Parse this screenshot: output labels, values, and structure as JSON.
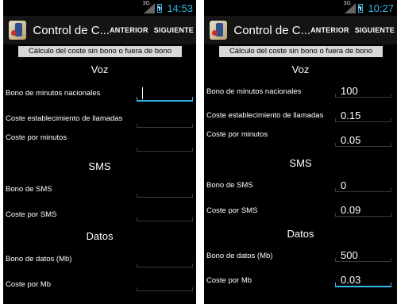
{
  "left": {
    "status": {
      "network": "3G",
      "time": "14:53"
    },
    "actionbar": {
      "title": "Control de C...",
      "prev": "ANTERIOR",
      "next": "SIGUIENTE"
    },
    "header": "Cálculo del coste sin bono o fuera de bono",
    "sections": {
      "voz": "Voz",
      "sms": "SMS",
      "datos": "Datos"
    },
    "labels": {
      "bono_minutos": "Bono de minutos nacionales",
      "coste_establecimiento": "Coste establecimiento de llamadas",
      "coste_minutos": "Coste por minutos",
      "bono_sms": "Bono de SMS",
      "coste_sms": "Coste por SMS",
      "bono_datos": "Bono de datos (Mb)",
      "coste_mb": "Coste por Mb"
    },
    "values": {
      "bono_minutos": "",
      "coste_establecimiento": "",
      "coste_minutos": "",
      "bono_sms": "",
      "coste_sms": "",
      "bono_datos": "",
      "coste_mb": ""
    }
  },
  "right": {
    "status": {
      "network": "3G",
      "time": "10:27"
    },
    "actionbar": {
      "title": "Control de C...",
      "prev": "ANTERIOR",
      "next": "SIGUIENTE"
    },
    "header": "Cálculo del coste sin bono o fuera de bono",
    "sections": {
      "voz": "Voz",
      "sms": "SMS",
      "datos": "Datos"
    },
    "labels": {
      "bono_minutos": "Bono de minutos nacionales",
      "coste_establecimiento": "Coste establecimiento de llamadas",
      "coste_minutos": "Coste por minutos",
      "bono_sms": "Bono de SMS",
      "coste_sms": "Coste por SMS",
      "bono_datos": "Bono de datos (Mb)",
      "coste_mb": "Coste por Mb"
    },
    "values": {
      "bono_minutos": "100",
      "coste_establecimiento": "0.15",
      "coste_minutos": "0.05",
      "bono_sms": "0",
      "coste_sms": "0.09",
      "bono_datos": "500",
      "coste_mb": "0.03"
    }
  },
  "colors": {
    "accent": "#33b5e5",
    "background": "#000000",
    "header_bg": "#d8d8d8"
  }
}
